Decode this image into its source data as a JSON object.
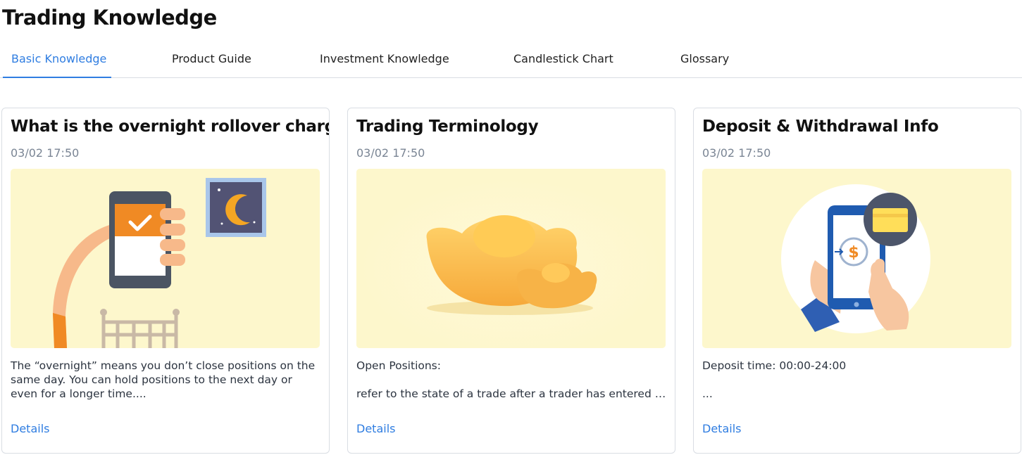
{
  "page": {
    "title": "Trading Knowledge"
  },
  "tabs": [
    {
      "label": "Basic Knowledge",
      "active": true
    },
    {
      "label": "Product Guide",
      "active": false
    },
    {
      "label": "Investment Knowledge",
      "active": false
    },
    {
      "label": "Candlestick Chart",
      "active": false
    },
    {
      "label": "Glossary",
      "active": false
    }
  ],
  "colors": {
    "accent": "#2f7de1",
    "image_background": "#fdf7cc"
  },
  "cards": [
    {
      "title": "What is the overnight rollover charge?",
      "date": "03/02 17:50",
      "image_icon": "phone-bed-moon-illustration",
      "excerpt": [
        "The “overnight” means you don’t close positions on the same day. You can hold positions to the next day or even for a longer time...."
      ],
      "link": "Details"
    },
    {
      "title": "Trading Terminology",
      "date": "03/02 17:50",
      "image_icon": "gold-ingot-illustration",
      "excerpt": [
        "Open Positions:",
        "",
        "refer to the state of a trade after a trader has entered the market. Traders can Buy or Sell to enter the"
      ],
      "link": "Details"
    },
    {
      "title": "Deposit & Withdrawal Info",
      "date": "03/02 17:50",
      "image_icon": "mobile-payment-illustration",
      "excerpt": [
        "Deposit time: 00:00-24:00",
        "",
        "..."
      ],
      "link": "Details"
    }
  ]
}
